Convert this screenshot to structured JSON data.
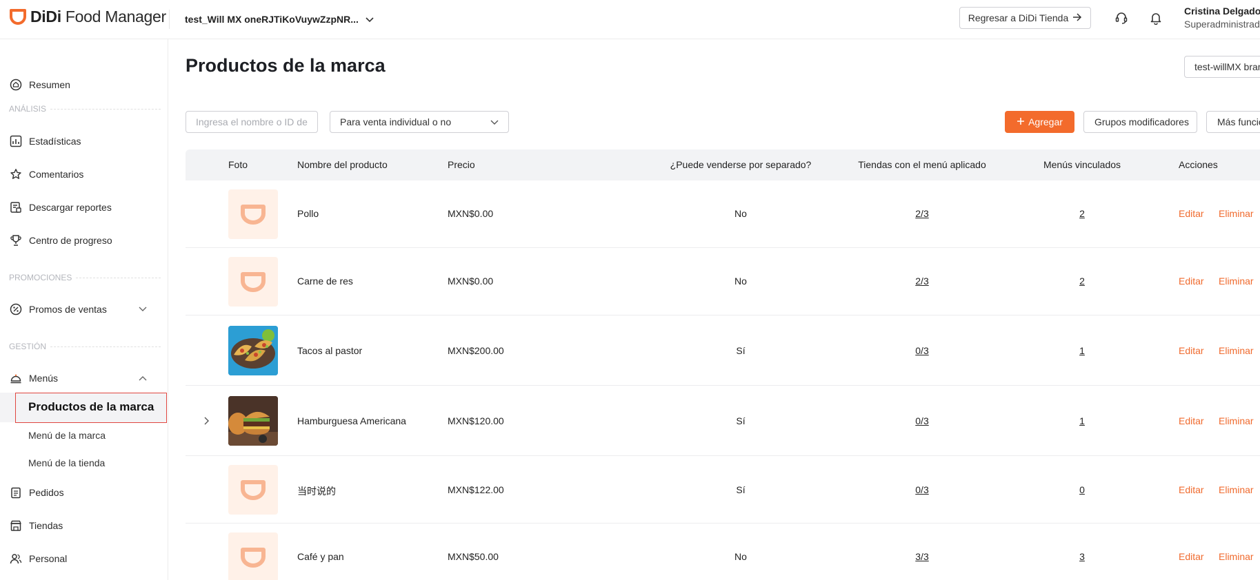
{
  "app": {
    "logo_text_bold": "DiDi",
    "logo_text": " Food Manager",
    "store_name": "test_Will MX oneRJTiKoVuywZzpNR...",
    "back_button": "Regresar a DiDi Tienda",
    "user_name": "Cristina Delgado",
    "user_role": "Superadministrador"
  },
  "sidebar": {
    "resumen": "Resumen",
    "section_analisis": "ANÁLISIS",
    "estadisticas": "Estadísticas",
    "comentarios": "Comentarios",
    "descargar": "Descargar reportes",
    "progreso": "Centro de progreso",
    "section_promociones": "PROMOCIONES",
    "promos": "Promos de ventas",
    "section_gestion": "GESTIÓN",
    "menus": "Menús",
    "sub_productos": "Productos de la marca",
    "sub_menu_marca": "Menú de la marca",
    "sub_menu_tienda": "Menú de la tienda",
    "pedidos": "Pedidos",
    "tiendas": "Tiendas",
    "personal": "Personal"
  },
  "main": {
    "title": "Productos de la marca",
    "brand_select": "test-willMX brand",
    "search_placeholder": "Ingresa el nombre o ID del producto",
    "filter_select": "Para venta individual o no",
    "add_button": "Agregar",
    "modifiers_button": "Grupos modificadores",
    "more_button": "Más funciones"
  },
  "table": {
    "headers": {
      "foto": "Foto",
      "nombre": "Nombre del producto",
      "precio": "Precio",
      "separado": "¿Puede venderse por separado?",
      "tiendas": "Tiendas con el menú aplicado",
      "menus": "Menús vinculados",
      "acciones": "Acciones"
    },
    "edit_label": "Editar",
    "delete_label": "Eliminar",
    "rows": [
      {
        "name": "Pollo",
        "price": "MXN$0.00",
        "separate": "No",
        "stores": "2/3",
        "menus": "2"
      },
      {
        "name": "Carne de res",
        "price": "MXN$0.00",
        "separate": "No",
        "stores": "2/3",
        "menus": "2"
      },
      {
        "name": "Tacos al pastor",
        "price": "MXN$200.00",
        "separate": "Sí",
        "stores": "0/3",
        "menus": "1"
      },
      {
        "name": "Hamburguesa Americana",
        "price": "MXN$120.00",
        "separate": "Sí",
        "stores": "0/3",
        "menus": "1"
      },
      {
        "name": "当时说的",
        "price": "MXN$122.00",
        "separate": "Sí",
        "stores": "0/3",
        "menus": "0"
      },
      {
        "name": "Café y pan",
        "price": "MXN$50.00",
        "separate": "No",
        "stores": "3/3",
        "menus": "3"
      }
    ]
  },
  "colors": {
    "accent": "#f36b2c",
    "link": "#f06a2d",
    "highlight_border": "#e0453f"
  }
}
